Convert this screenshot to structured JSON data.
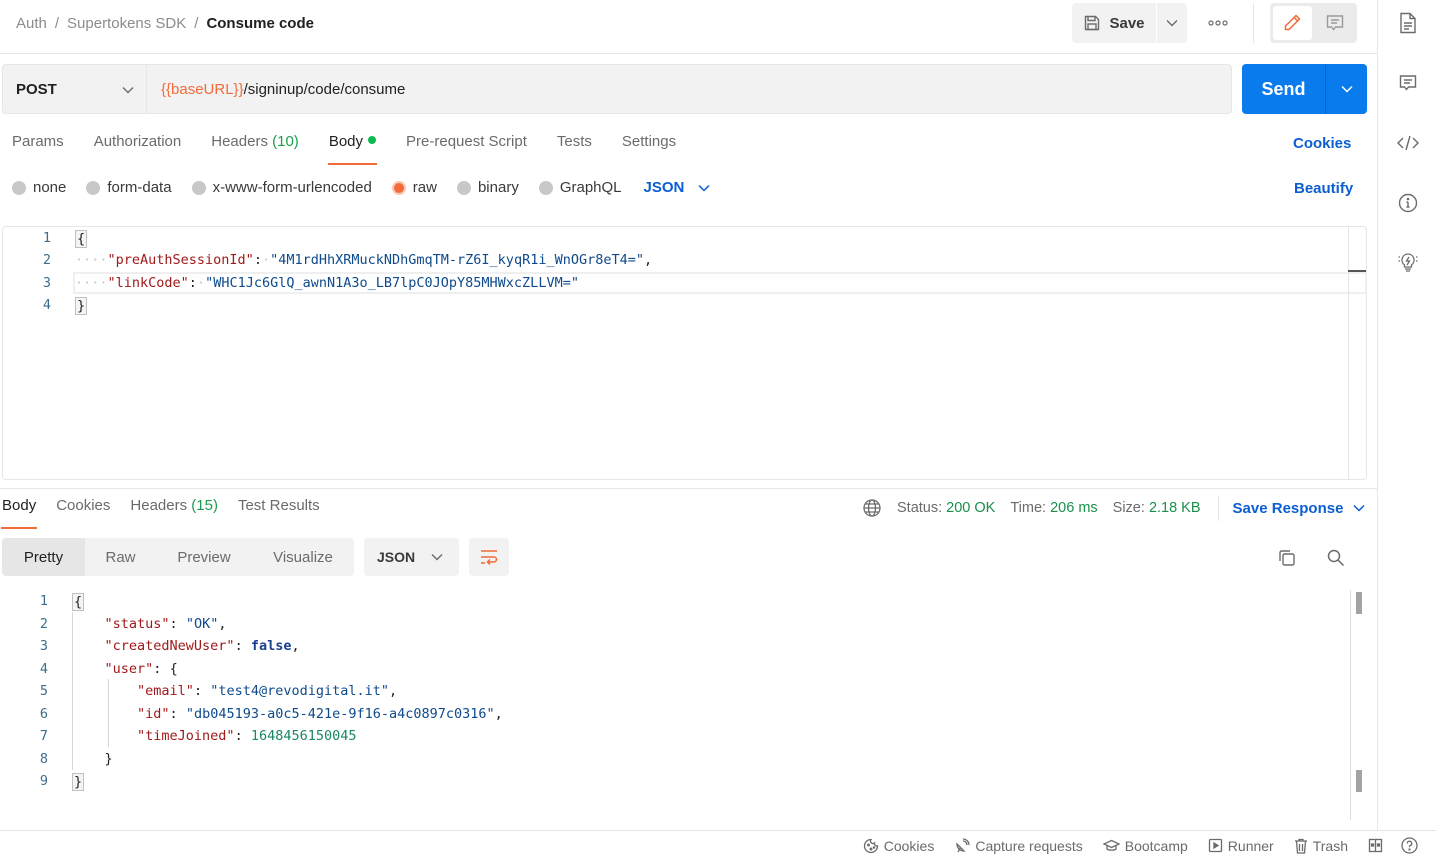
{
  "header": {
    "breadcrumb": [
      "Auth",
      "Supertokens SDK",
      "Consume code"
    ],
    "separator": "/",
    "save_label": "Save",
    "more_label": "ooo"
  },
  "request": {
    "method": "POST",
    "url_variable": "{{baseURL}}",
    "url_path": "/signinup/code/consume",
    "send_label": "Send",
    "tabs": [
      {
        "label": "Params"
      },
      {
        "label": "Authorization"
      },
      {
        "label": "Headers",
        "count": "(10)"
      },
      {
        "label": "Body",
        "active": true
      },
      {
        "label": "Pre-request Script"
      },
      {
        "label": "Tests"
      },
      {
        "label": "Settings"
      }
    ],
    "cookies_label": "Cookies",
    "body_types": [
      "none",
      "form-data",
      "x-www-form-urlencoded",
      "raw",
      "binary",
      "GraphQL"
    ],
    "selected_body_type": "raw",
    "body_language": "JSON",
    "beautify_label": "Beautify",
    "body_lines": {
      "numbers": [
        "1",
        "2",
        "3",
        "4"
      ],
      "open": "{",
      "close": "}",
      "key1": "\"preAuthSessionId\"",
      "val1": "\"4M1rdHhXRMuckNDhGmqTM-rZ6I_kyqR1i_WnOGr8eT4=\"",
      "key2": "\"linkCode\"",
      "val2": "\"WHC1Jc6GlQ_awnN1A3o_LB7lpC0JOpY85MHWxcZLLVM=\""
    }
  },
  "response": {
    "tabs": [
      {
        "label": "Body",
        "active": true
      },
      {
        "label": "Cookies"
      },
      {
        "label": "Headers",
        "count": "(15)"
      },
      {
        "label": "Test Results"
      }
    ],
    "status_label": "Status:",
    "status_value": "200 OK",
    "time_label": "Time:",
    "time_value": "206 ms",
    "size_label": "Size:",
    "size_value": "2.18 KB",
    "save_response_label": "Save Response",
    "views": [
      "Pretty",
      "Raw",
      "Preview",
      "Visualize"
    ],
    "active_view": "Pretty",
    "language": "JSON",
    "body_lines": {
      "numbers": [
        "1",
        "2",
        "3",
        "4",
        "5",
        "6",
        "7",
        "8",
        "9"
      ],
      "open": "{",
      "close": "}",
      "status_key": "\"status\"",
      "status_val": "\"OK\"",
      "created_key": "\"createdNewUser\"",
      "created_val": "false",
      "user_key": "\"user\"",
      "email_key": "\"email\"",
      "email_val": "\"test4@revodigital.it\"",
      "id_key": "\"id\"",
      "id_val": "\"db045193-a0c5-421e-9f16-a4c0897c0316\"",
      "time_key": "\"timeJoined\"",
      "time_val": "1648456150045"
    }
  },
  "statusbar": {
    "items": [
      "Cookies",
      "Capture requests",
      "Bootcamp",
      "Runner",
      "Trash"
    ]
  },
  "colors": {
    "accent": "#f26b3a",
    "primary": "#097bed",
    "link": "#0b5fd1",
    "success": "#1a8f4c"
  }
}
